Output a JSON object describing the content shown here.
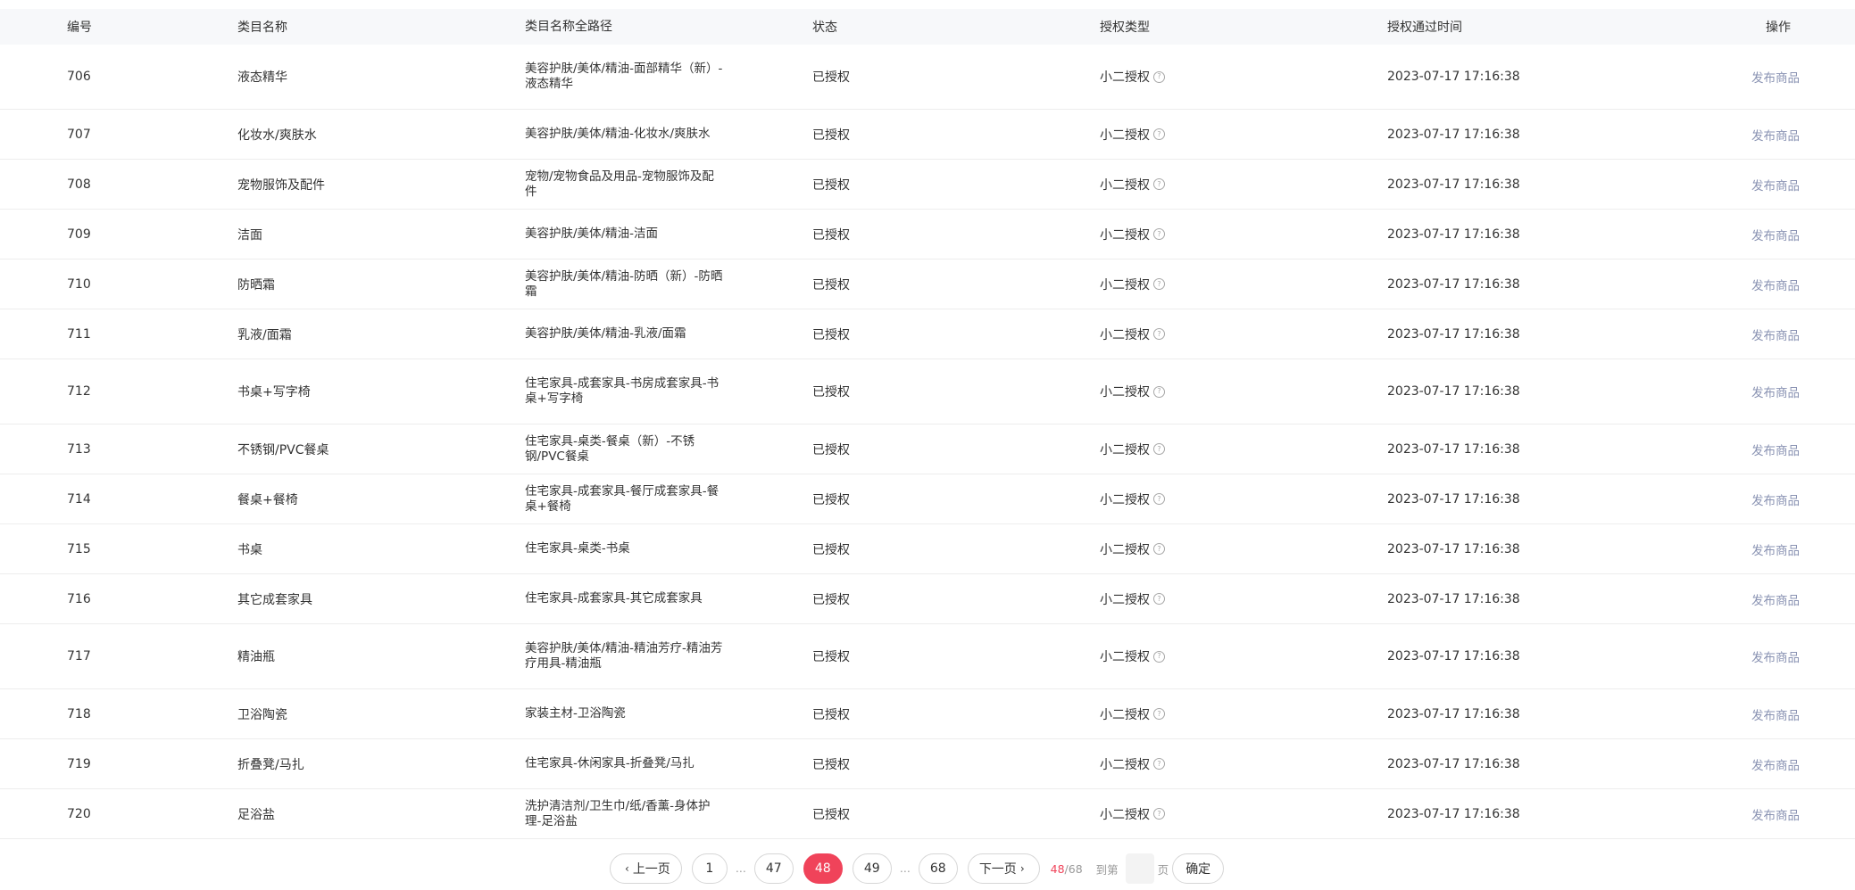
{
  "table": {
    "headers": {
      "id": "编号",
      "name": "类目名称",
      "path": "类目名称全路径",
      "status": "状态",
      "auth_type": "授权类型",
      "auth_time": "授权通过时间",
      "op": "操作"
    },
    "rows": [
      {
        "id": "706",
        "name": "液态精华",
        "path": "美容护肤/美体/精油-面部精华（新）-液态精华",
        "status": "已授权",
        "auth_type": "小二授权",
        "auth_time": "2023-07-17 17:16:38",
        "op": "发布商品"
      },
      {
        "id": "707",
        "name": "化妆水/爽肤水",
        "path": "美容护肤/美体/精油-化妆水/爽肤水",
        "status": "已授权",
        "auth_type": "小二授权",
        "auth_time": "2023-07-17 17:16:38",
        "op": "发布商品"
      },
      {
        "id": "708",
        "name": "宠物服饰及配件",
        "path": "宠物/宠物食品及用品-宠物服饰及配件",
        "status": "已授权",
        "auth_type": "小二授权",
        "auth_time": "2023-07-17 17:16:38",
        "op": "发布商品"
      },
      {
        "id": "709",
        "name": "洁面",
        "path": "美容护肤/美体/精油-洁面",
        "status": "已授权",
        "auth_type": "小二授权",
        "auth_time": "2023-07-17 17:16:38",
        "op": "发布商品"
      },
      {
        "id": "710",
        "name": "防晒霜",
        "path": "美容护肤/美体/精油-防晒（新）-防晒霜",
        "status": "已授权",
        "auth_type": "小二授权",
        "auth_time": "2023-07-17 17:16:38",
        "op": "发布商品"
      },
      {
        "id": "711",
        "name": "乳液/面霜",
        "path": "美容护肤/美体/精油-乳液/面霜",
        "status": "已授权",
        "auth_type": "小二授权",
        "auth_time": "2023-07-17 17:16:38",
        "op": "发布商品"
      },
      {
        "id": "712",
        "name": "书桌+写字椅",
        "path": "住宅家具-成套家具-书房成套家具-书桌+写字椅",
        "status": "已授权",
        "auth_type": "小二授权",
        "auth_time": "2023-07-17 17:16:38",
        "op": "发布商品"
      },
      {
        "id": "713",
        "name": "不锈钢/PVC餐桌",
        "path": "住宅家具-桌类-餐桌（新）-不锈钢/PVC餐桌",
        "status": "已授权",
        "auth_type": "小二授权",
        "auth_time": "2023-07-17 17:16:38",
        "op": "发布商品"
      },
      {
        "id": "714",
        "name": "餐桌+餐椅",
        "path": "住宅家具-成套家具-餐厅成套家具-餐桌+餐椅",
        "status": "已授权",
        "auth_type": "小二授权",
        "auth_time": "2023-07-17 17:16:38",
        "op": "发布商品"
      },
      {
        "id": "715",
        "name": "书桌",
        "path": "住宅家具-桌类-书桌",
        "status": "已授权",
        "auth_type": "小二授权",
        "auth_time": "2023-07-17 17:16:38",
        "op": "发布商品"
      },
      {
        "id": "716",
        "name": "其它成套家具",
        "path": "住宅家具-成套家具-其它成套家具",
        "status": "已授权",
        "auth_type": "小二授权",
        "auth_time": "2023-07-17 17:16:38",
        "op": "发布商品"
      },
      {
        "id": "717",
        "name": "精油瓶",
        "path": "美容护肤/美体/精油-精油芳疗-精油芳疗用具-精油瓶",
        "status": "已授权",
        "auth_type": "小二授权",
        "auth_time": "2023-07-17 17:16:38",
        "op": "发布商品"
      },
      {
        "id": "718",
        "name": "卫浴陶瓷",
        "path": "家装主材-卫浴陶瓷",
        "status": "已授权",
        "auth_type": "小二授权",
        "auth_time": "2023-07-17 17:16:38",
        "op": "发布商品"
      },
      {
        "id": "719",
        "name": "折叠凳/马扎",
        "path": "住宅家具-休闲家具-折叠凳/马扎",
        "status": "已授权",
        "auth_type": "小二授权",
        "auth_time": "2023-07-17 17:16:38",
        "op": "发布商品"
      },
      {
        "id": "720",
        "name": "足浴盐",
        "path": "洗护清洁剂/卫生巾/纸/香薰-身体护理-足浴盐",
        "status": "已授权",
        "auth_type": "小二授权",
        "auth_time": "2023-07-17 17:16:38",
        "op": "发布商品"
      }
    ]
  },
  "pagination": {
    "prev_label": "上一页",
    "next_label": "下一页",
    "pages": [
      "1",
      "…",
      "47",
      "48",
      "49",
      "…",
      "68"
    ],
    "current": "48",
    "total": "68",
    "goto_prefix": "到第",
    "goto_suffix": "页",
    "goto_value": "",
    "confirm_label": "确定"
  },
  "colors": {
    "accent": "#f0435a",
    "link": "#8a93b3",
    "header_bg": "#f7f8fa"
  },
  "icons": {
    "auth_help": "question-circle-icon",
    "prev": "chevron-left-icon",
    "next": "chevron-right-icon"
  }
}
